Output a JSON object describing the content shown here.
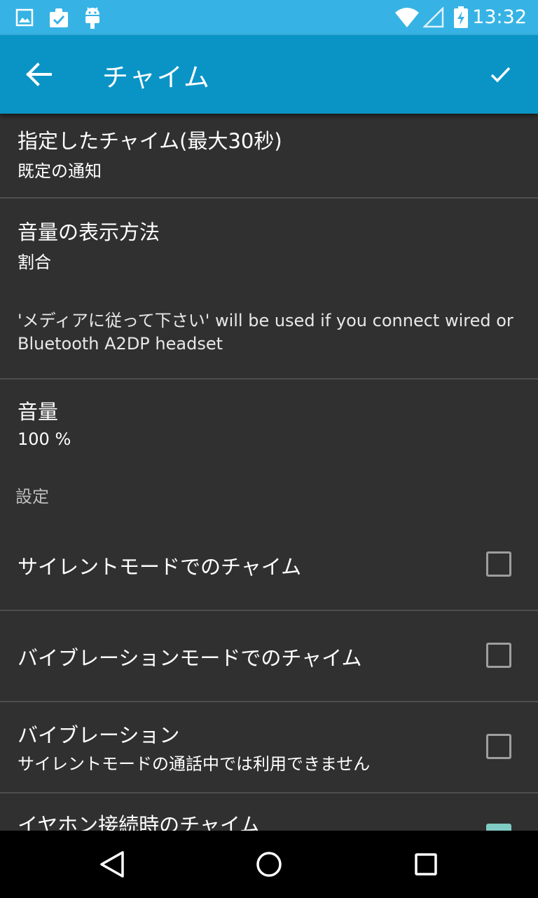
{
  "status_bar": {
    "time": "13:32",
    "background": "#36b3e4",
    "left_icons": [
      "image-icon",
      "clipboard-check-icon",
      "android-icon"
    ],
    "right_icons": [
      "wifi-icon",
      "cell-signal-icon",
      "battery-charging-icon"
    ]
  },
  "app_bar": {
    "title": "チャイム",
    "background": "#0a94c6",
    "back_icon": "arrow-left-icon",
    "confirm_icon": "check-icon"
  },
  "settings": {
    "chime_sound": {
      "title": "指定したチャイム(最大30秒)",
      "value": "既定の通知"
    },
    "volume_display": {
      "title": "音量の表示方法",
      "value": "割合"
    },
    "wired_note": "'メディアに従って下さい' will be used if you connect wired or Bluetooth A2DP headset",
    "volume": {
      "title": "音量",
      "value": "100 %"
    },
    "section_header": "設定",
    "silent_mode_chime": {
      "title": "サイレントモードでのチャイム",
      "checked": false
    },
    "vibration_mode_chime": {
      "title": "バイブレーションモードでのチャイム",
      "checked": false
    },
    "vibration": {
      "title": "バイブレーション",
      "summary": "サイレントモードの通話中では利用できません",
      "checked": false
    },
    "earphone_chime": {
      "title": "イヤホン接続時のチャイム",
      "checked": true
    }
  },
  "accent_color": "#80cbc4",
  "nav_bar": {
    "icons": [
      "back-triangle-icon",
      "home-circle-icon",
      "recents-square-icon"
    ]
  }
}
